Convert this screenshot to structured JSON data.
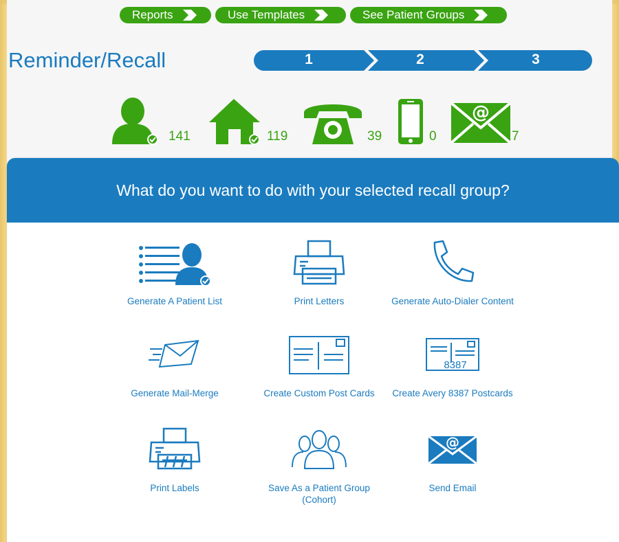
{
  "nav": {
    "reports": "Reports",
    "templates": "Use Templates",
    "groups": "See Patient Groups"
  },
  "page_title": "Reminder/Recall",
  "steps": [
    "1",
    "2",
    "3"
  ],
  "stats": {
    "patients": "141",
    "address": "119",
    "phone": "39",
    "mobile": "0",
    "email": "7"
  },
  "panel": {
    "heading": "What do you want to do with your selected recall group?",
    "actions": {
      "patient_list": "Generate A Patient List",
      "print_letters": "Print Letters",
      "auto_dialer": "Generate Auto-Dialer Content",
      "mail_merge": "Generate Mail-Merge",
      "custom_postcards": "Create Custom Post Cards",
      "avery_postcards": "Create Avery 8387 Postcards",
      "avery_number": "8387",
      "print_labels": "Print Labels",
      "save_group": "Save As a Patient Group (Cohort)",
      "send_email": "Send Email"
    }
  },
  "colors": {
    "green": "#3aa312",
    "blue": "#1a7bbf",
    "panel_bg": "#ffffff"
  }
}
